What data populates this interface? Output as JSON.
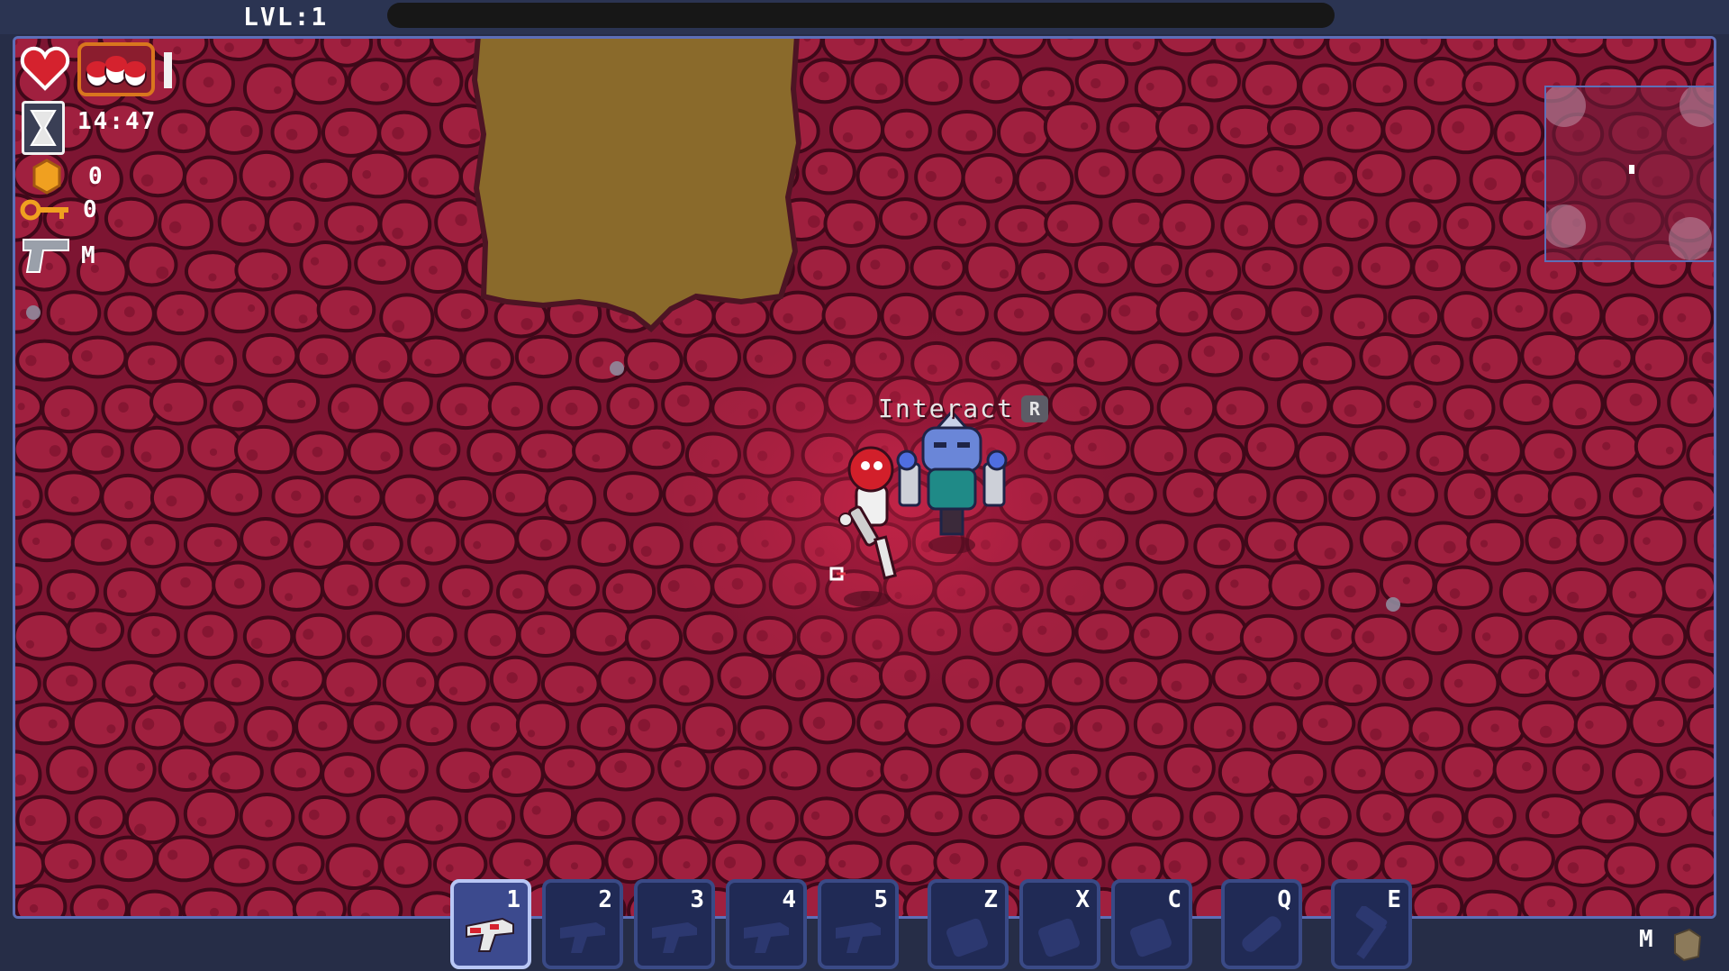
{
  "hud_top": {
    "level_label": "LVL:1",
    "xp_progress": 0
  },
  "hud_left": {
    "timer": "14:47",
    "coins": "0",
    "keys": "0",
    "weapon_label": "M"
  },
  "interact_prompt": {
    "label": "Interact",
    "key": "R"
  },
  "hotbar": {
    "slots": [
      {
        "key": "1",
        "icon": "raygun-icon",
        "active": true
      },
      {
        "key": "2",
        "icon": "gun-silhouette-icon",
        "active": false
      },
      {
        "key": "3",
        "icon": "gun-silhouette-icon",
        "active": false
      },
      {
        "key": "4",
        "icon": "gun-silhouette-icon",
        "active": false
      },
      {
        "key": "5",
        "icon": "gun-silhouette-icon",
        "active": false
      },
      {
        "key": "Z",
        "icon": "ability-silhouette-icon",
        "active": false
      },
      {
        "key": "X",
        "icon": "ability-silhouette-icon",
        "active": false
      },
      {
        "key": "C",
        "icon": "ability-silhouette-icon",
        "active": false
      },
      {
        "key": "Q",
        "icon": "bandage-silhouette-icon",
        "active": false
      },
      {
        "key": "E",
        "icon": "hammer-silhouette-icon",
        "active": false
      }
    ]
  },
  "map_hint": {
    "key": "M"
  },
  "colors": {
    "flesh_tile": "#a0203f",
    "flesh_background": "#7d1532",
    "dirt": "#8a6a2b",
    "hud_frame": "#5d6fb8",
    "hotbar_slot": "#202a55",
    "hotbar_active": "#3c4a8e"
  }
}
